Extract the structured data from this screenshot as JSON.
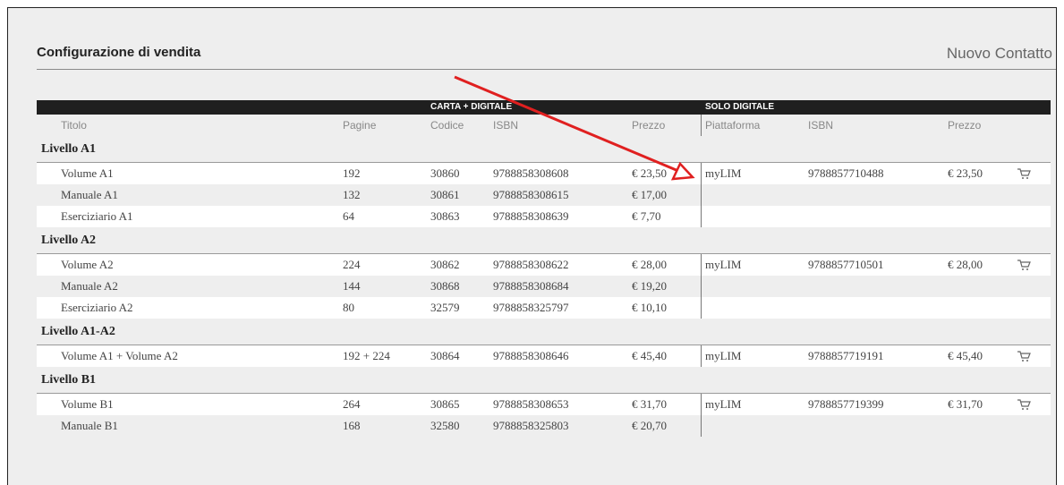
{
  "header": {
    "title": "Configurazione di vendita",
    "contact_link": "Nuovo Contatto"
  },
  "groups": {
    "paper_digital": "CARTA + DIGITALE",
    "digital_only": "SOLO DIGITALE"
  },
  "columns": {
    "titolo": "Titolo",
    "pagine": "Pagine",
    "codice": "Codice",
    "isbn": "ISBN",
    "prezzo": "Prezzo",
    "piattaforma": "Piattaforma",
    "isbn_digitale": "ISBN",
    "prezzo_digitale": "Prezzo"
  },
  "levels": [
    {
      "name": "Livello A1",
      "items": [
        {
          "titolo": "Volume A1",
          "pagine": "192",
          "codice": "30860",
          "isbn": "9788858308608",
          "prezzo": "€ 23,50",
          "piattaforma": "myLIM",
          "isbn_digitale": "9788857710488",
          "prezzo_digitale": "€ 23,50",
          "cart": true
        },
        {
          "titolo": "Manuale A1",
          "pagine": "132",
          "codice": "30861",
          "isbn": "9788858308615",
          "prezzo": "€ 17,00",
          "piattaforma": "",
          "isbn_digitale": "",
          "prezzo_digitale": "",
          "cart": false
        },
        {
          "titolo": "Eserciziario A1",
          "pagine": "64",
          "codice": "30863",
          "isbn": "9788858308639",
          "prezzo": "€ 7,70",
          "piattaforma": "",
          "isbn_digitale": "",
          "prezzo_digitale": "",
          "cart": false
        }
      ]
    },
    {
      "name": "Livello A2",
      "items": [
        {
          "titolo": "Volume A2",
          "pagine": "224",
          "codice": "30862",
          "isbn": "9788858308622",
          "prezzo": "€ 28,00",
          "piattaforma": "myLIM",
          "isbn_digitale": "9788857710501",
          "prezzo_digitale": "€ 28,00",
          "cart": true
        },
        {
          "titolo": "Manuale A2",
          "pagine": "144",
          "codice": "30868",
          "isbn": "9788858308684",
          "prezzo": "€ 19,20",
          "piattaforma": "",
          "isbn_digitale": "",
          "prezzo_digitale": "",
          "cart": false
        },
        {
          "titolo": "Eserciziario A2",
          "pagine": "80",
          "codice": "32579",
          "isbn": "9788858325797",
          "prezzo": "€ 10,10",
          "piattaforma": "",
          "isbn_digitale": "",
          "prezzo_digitale": "",
          "cart": false
        }
      ]
    },
    {
      "name": "Livello A1-A2",
      "items": [
        {
          "titolo": "Volume A1 + Volume A2",
          "pagine": "192 + 224",
          "codice": "30864",
          "isbn": "9788858308646",
          "prezzo": "€ 45,40",
          "piattaforma": "myLIM",
          "isbn_digitale": "9788857719191",
          "prezzo_digitale": "€ 45,40",
          "cart": true
        }
      ]
    },
    {
      "name": "Livello B1",
      "items": [
        {
          "titolo": "Volume B1",
          "pagine": "264",
          "codice": "30865",
          "isbn": "9788858308653",
          "prezzo": "€ 31,70",
          "piattaforma": "myLIM",
          "isbn_digitale": "9788857719399",
          "prezzo_digitale": "€ 31,70",
          "cart": true
        },
        {
          "titolo": "Manuale B1",
          "pagine": "168",
          "codice": "32580",
          "isbn": "9788858325803",
          "prezzo": "€ 20,70",
          "piattaforma": "",
          "isbn_digitale": "",
          "prezzo_digitale": "",
          "cart": false
        }
      ]
    }
  ],
  "icons": {
    "cart": "shopping-cart-icon",
    "annotation": "red-arrow-annotation"
  },
  "colors": {
    "background": "#eeeeee",
    "group_bar": "#1f1f1f",
    "annotation_arrow": "#e02020"
  }
}
